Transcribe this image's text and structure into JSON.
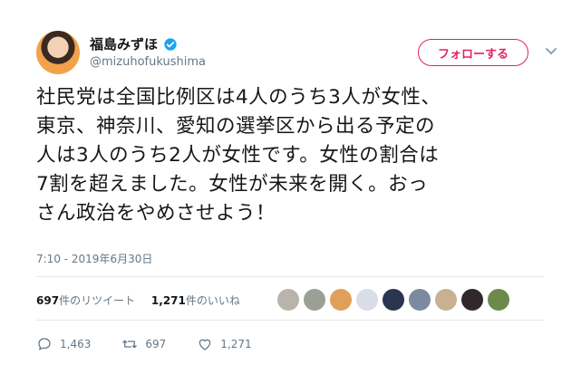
{
  "user": {
    "display_name": "福島みずほ",
    "handle": "@mizuhofukushima",
    "verified": true
  },
  "follow_button": {
    "label": "フォローする",
    "color": "#e0245e"
  },
  "tweet": {
    "lines": [
      "社民党は全国比例区は4人のうち3人が女性、",
      "東京、神奈川、愛知の選挙区から出る予定の",
      "人は3人のうち2人が女性です。女性の割合は",
      "7割を超えました。女性が未来を開く。おっ",
      "さん政治をやめさせよう！"
    ],
    "timestamp": "7:10 - 2019年6月30日"
  },
  "stats": {
    "retweets_count": "697",
    "retweets_label": "件のリツイート",
    "likes_count": "1,271",
    "likes_label": "件のいいね"
  },
  "liker_avatars": [
    "#b9b3ab",
    "#9aa093",
    "#e0a05a",
    "#d8dde6",
    "#2a3550",
    "#7c8aa0",
    "#c8b090",
    "#30282a",
    "#6e8a4a"
  ],
  "actions": {
    "replies": "1,463",
    "retweets": "697",
    "likes": "1,271"
  },
  "icons": [
    "verified-badge-icon",
    "chevron-down-icon",
    "reply-icon",
    "retweet-icon",
    "like-icon"
  ]
}
